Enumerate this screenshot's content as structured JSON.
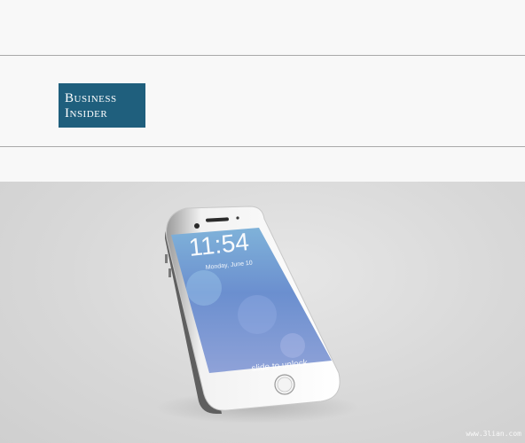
{
  "logo": {
    "line1": "Business",
    "line2": "Insider",
    "bg_color": "#1f5f7d"
  },
  "phone_screen": {
    "time": "11:54",
    "date": "Monday, June 10",
    "unlock_text": "slide to unlock"
  },
  "watermark": "www.3lian.com"
}
